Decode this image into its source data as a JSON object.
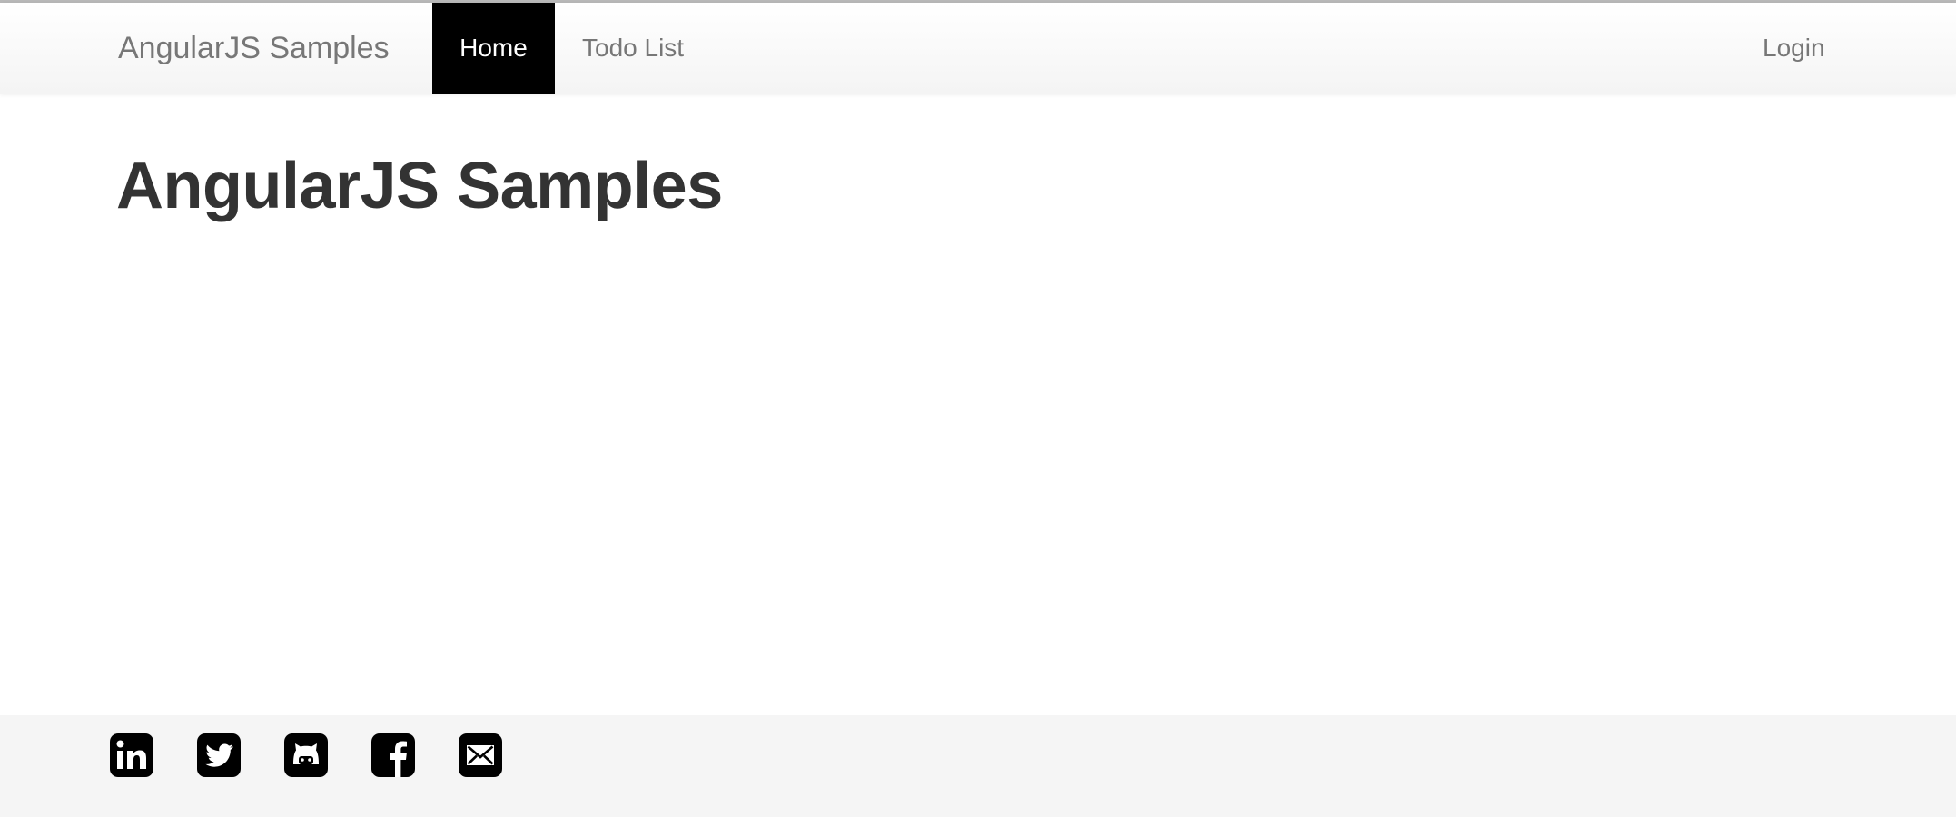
{
  "navbar": {
    "brand": "AngularJS Samples",
    "items": [
      {
        "label": "Home",
        "active": true
      },
      {
        "label": "Todo List",
        "active": false
      }
    ],
    "right_item": {
      "label": "Login"
    },
    "active_bg_color": "#000000",
    "active_text_color": "#ffffff",
    "text_color": "#777777"
  },
  "main": {
    "title": "AngularJS Samples"
  },
  "footer": {
    "social_icons": [
      {
        "name": "linkedin-icon"
      },
      {
        "name": "twitter-icon"
      },
      {
        "name": "github-icon"
      },
      {
        "name": "facebook-icon"
      },
      {
        "name": "email-icon"
      }
    ],
    "background_color": "#f5f5f5"
  }
}
